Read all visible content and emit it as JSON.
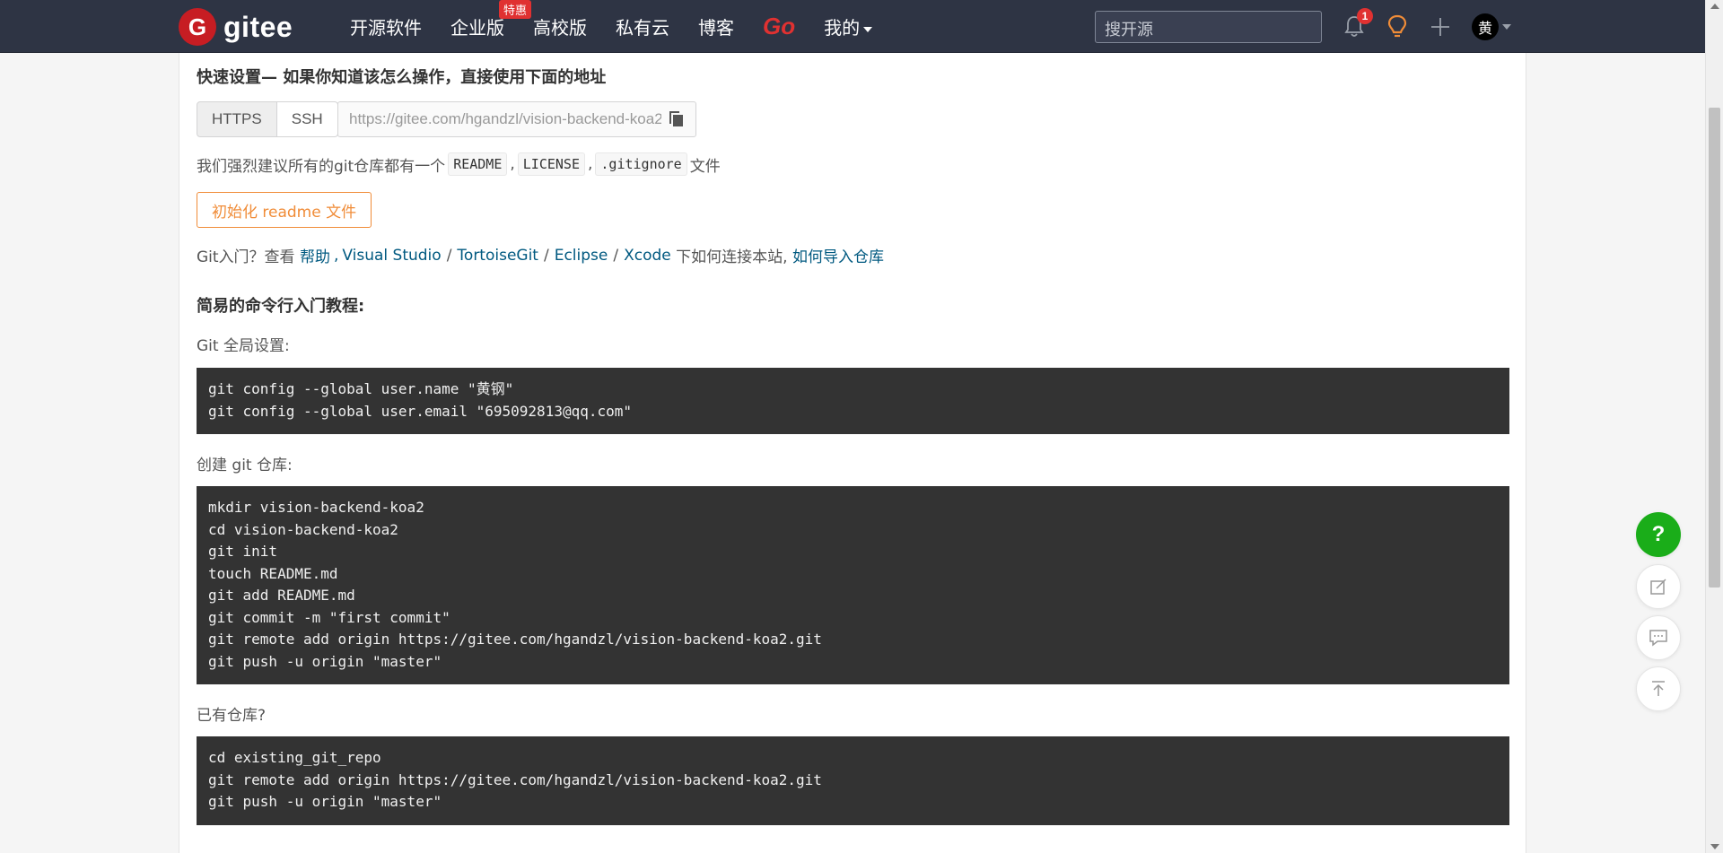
{
  "navbar": {
    "logo_letter": "G",
    "logo_text": "gitee",
    "links": [
      "开源软件",
      "企业版",
      "高校版",
      "私有云",
      "博客"
    ],
    "enterprise_badge": "特惠",
    "go_label": "Go",
    "mine_label": "我的",
    "search_placeholder": "搜开源",
    "notification_count": "1",
    "avatar_text": "黄",
    "accent_color": "#c71d23"
  },
  "quick_setup": {
    "title": "快速设置— 如果你知道该怎么操作，直接使用下面的地址",
    "https_label": "HTTPS",
    "ssh_label": "SSH",
    "url": "https://gitee.com/hgandzl/vision-backend-koa2.git",
    "recommend_prefix": "我们强烈建议所有的git仓库都有一个",
    "readme_chip": "README",
    "license_chip": "LICENSE",
    "gitignore_chip": ".gitignore",
    "comma": ",",
    "recommend_suffix": "文件",
    "init_readme_button": "初始化 readme 文件",
    "intro_prefix": "Git入门？查看",
    "help_link": "帮助",
    "vs_link": "Visual Studio",
    "tortoise_link": "TortoiseGit",
    "eclipse_link": "Eclipse",
    "xcode_link": "Xcode",
    "intro_middle": "下如何连接本站,",
    "import_link": "如何导入仓库",
    "slash": "/",
    "comma_link": ","
  },
  "tutorial": {
    "title": "简易的命令行入门教程:",
    "global_label": "Git 全局设置:",
    "global_code": "git config --global user.name \"黄钢\"\ngit config --global user.email \"695092813@qq.com\"",
    "create_label": "创建 git 仓库:",
    "create_code": "mkdir vision-backend-koa2\ncd vision-backend-koa2\ngit init\ntouch README.md\ngit add README.md\ngit commit -m \"first commit\"\ngit remote add origin https://gitee.com/hgandzl/vision-backend-koa2.git\ngit push -u origin \"master\"",
    "existing_label": "已有仓库?",
    "existing_code": "cd existing_git_repo\ngit remote add origin https://gitee.com/hgandzl/vision-backend-koa2.git\ngit push -u origin \"master\""
  },
  "floating": {
    "help_glyph": "?"
  }
}
